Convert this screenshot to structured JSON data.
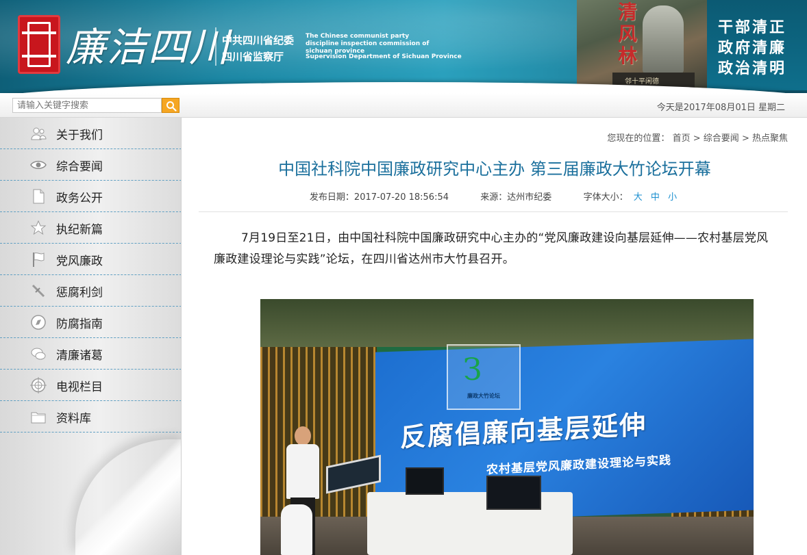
{
  "header": {
    "logo_text": "廉洁四川",
    "org_cn_line1": "中共四川省纪委",
    "org_cn_line2": "四川省监察厅",
    "org_en_line1": "The Chinese communist party discipline inspection commission of sichuan province",
    "org_en_line2": "Supervision Department of Sichuan Province",
    "photo_calligraphy": "清风林",
    "photo_plaque": "邻十平闲德",
    "motto": [
      "干部清正",
      "政府清廉",
      "政治清明"
    ],
    "colors": {
      "banner": "#1a86a3",
      "seal": "#c8161d"
    }
  },
  "search": {
    "placeholder": "请输入关键字搜索",
    "button_icon": "search-icon",
    "date_text": "今天是2017年08月01日 星期二"
  },
  "sidebar": {
    "items": [
      {
        "label": "关于我们",
        "icon": "people-icon"
      },
      {
        "label": "综合要闻",
        "icon": "eye-icon"
      },
      {
        "label": "政务公开",
        "icon": "document-icon"
      },
      {
        "label": "执纪新篇",
        "icon": "star-icon"
      },
      {
        "label": "党风廉政",
        "icon": "flag-icon"
      },
      {
        "label": "惩腐利剑",
        "icon": "sword-icon"
      },
      {
        "label": "防腐指南",
        "icon": "compass-icon"
      },
      {
        "label": "清廉诸葛",
        "icon": "chat-icon"
      },
      {
        "label": "电视栏目",
        "icon": "target-icon"
      },
      {
        "label": "资料库",
        "icon": "folder-icon"
      }
    ]
  },
  "breadcrumb": {
    "prefix": "您现在的位置：",
    "items": [
      "首页",
      "综合要闻",
      "热点聚焦"
    ],
    "sep": ">"
  },
  "article": {
    "title": "中国社科院中国廉政研究中心主办 第三届廉政大竹论坛开幕",
    "publish_label": "发布日期：",
    "publish_date": "2017-07-20 18:56:54",
    "source_label": "来源：",
    "source": "达州市纪委",
    "font_size_label": "字体大小：",
    "font_sizes": [
      "大",
      "中",
      "小"
    ],
    "paragraph": "7月19日至21日，由中国社科院中国廉政研究中心主办的“党风廉政建设向基层延伸——农村基层党风廉政建设理论与实践”论坛，在四川省达州市大竹县召开。",
    "photo": {
      "banner_main": "反腐倡廉向基层延伸",
      "banner_sub": "农村基层党风廉政建设理论与实践",
      "logo_text": "廉政大竹论坛"
    },
    "colors": {
      "title": "#1a6f9c",
      "link": "#1a8fd0"
    }
  }
}
